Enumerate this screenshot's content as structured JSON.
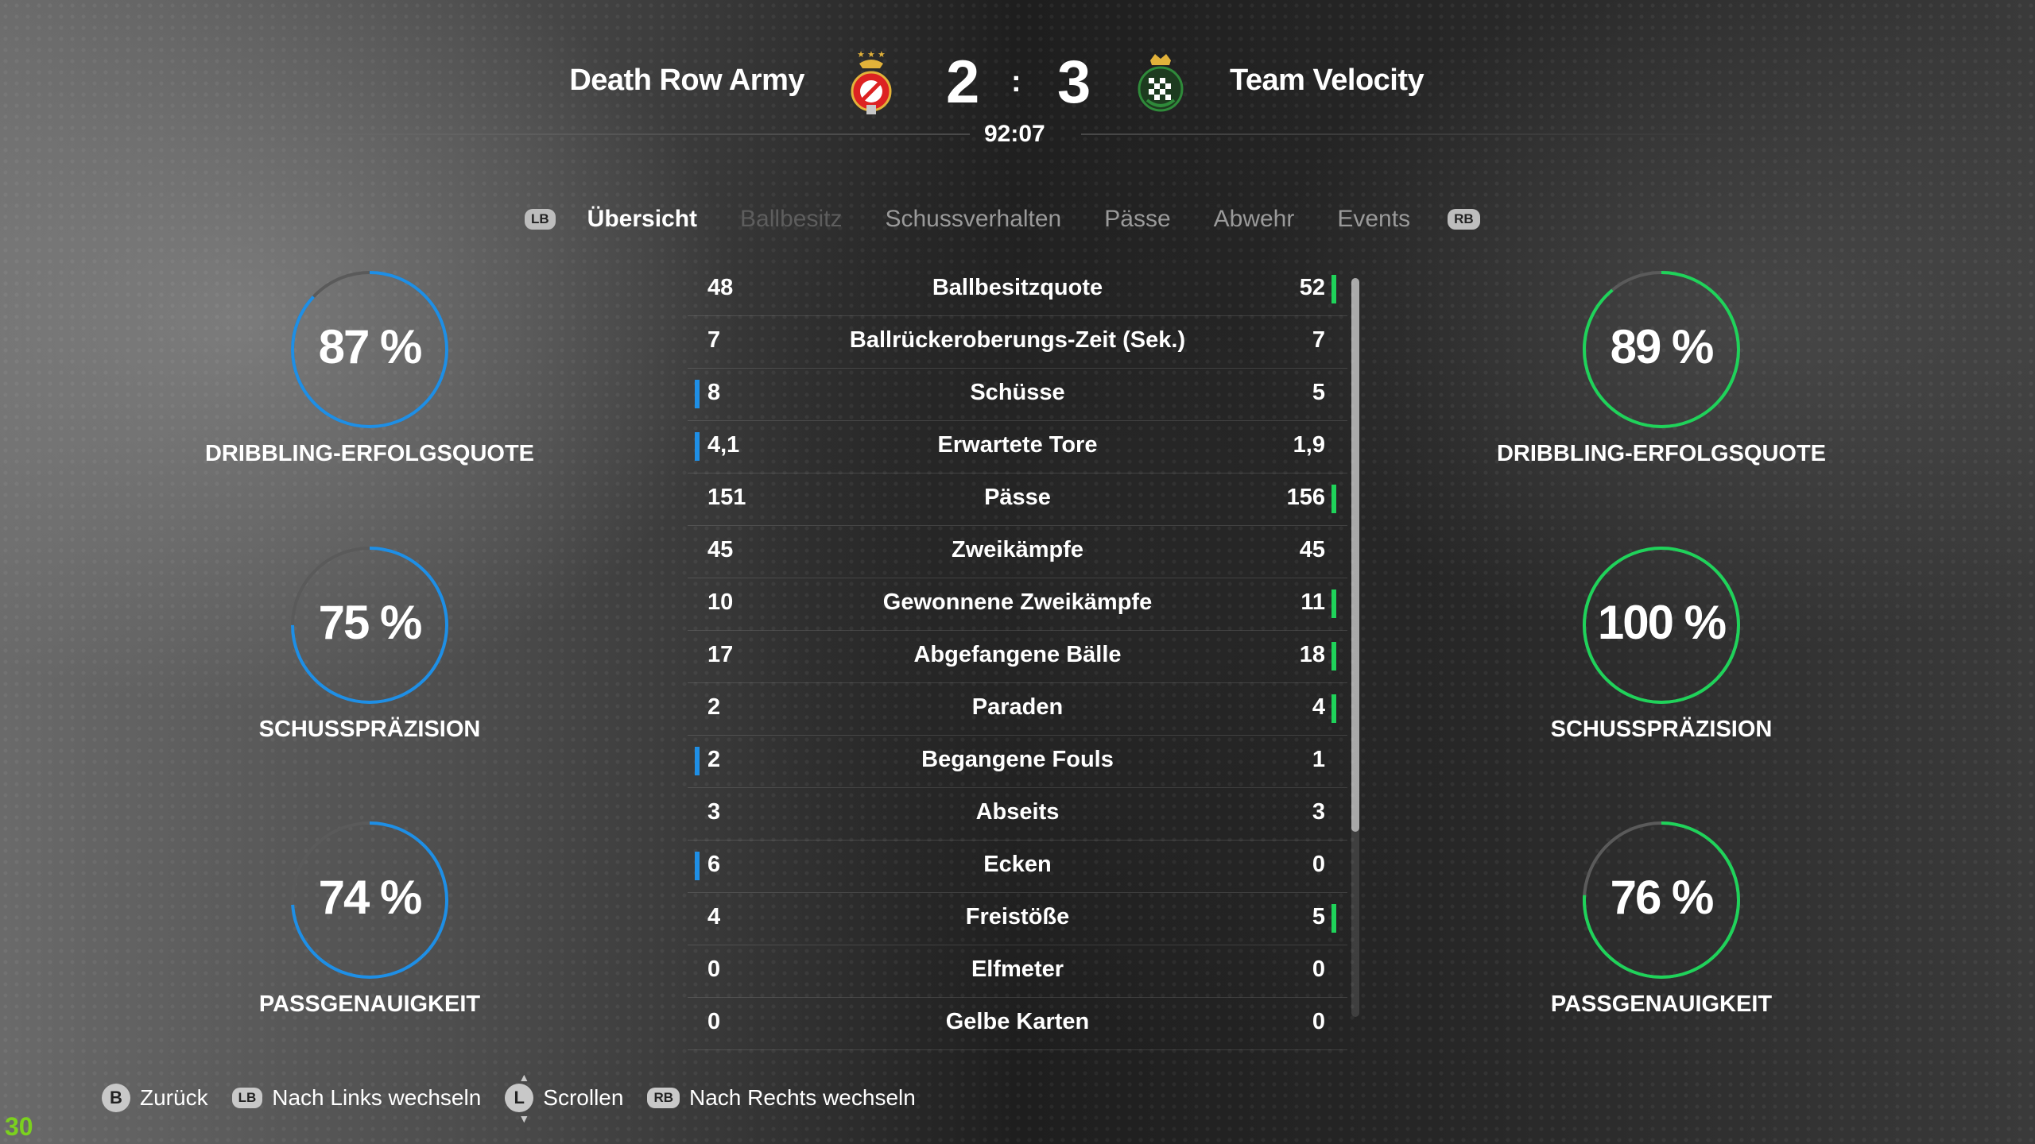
{
  "header": {
    "home_team": "Death Row Army",
    "away_team": "Team Velocity",
    "home_score": "2",
    "away_score": "3",
    "score_separator": ":",
    "match_clock": "92:07"
  },
  "tabs": {
    "lb_hint": "LB",
    "rb_hint": "RB",
    "items": [
      "Übersicht",
      "Ballbesitz",
      "Schussverhalten",
      "Pässe",
      "Abwehr",
      "Events"
    ],
    "active": "Übersicht"
  },
  "stats": [
    {
      "name": "Ballbesitzquote",
      "home": "48",
      "away": "52",
      "leader": "away"
    },
    {
      "name": "Ballrückeroberungs-Zeit (Sek.)",
      "home": "7",
      "away": "7",
      "leader": "none"
    },
    {
      "name": "Schüsse",
      "home": "8",
      "away": "5",
      "leader": "home"
    },
    {
      "name": "Erwartete Tore",
      "home": "4,1",
      "away": "1,9",
      "leader": "home"
    },
    {
      "name": "Pässe",
      "home": "151",
      "away": "156",
      "leader": "away"
    },
    {
      "name": "Zweikämpfe",
      "home": "45",
      "away": "45",
      "leader": "none"
    },
    {
      "name": "Gewonnene Zweikämpfe",
      "home": "10",
      "away": "11",
      "leader": "away"
    },
    {
      "name": "Abgefangene Bälle",
      "home": "17",
      "away": "18",
      "leader": "away"
    },
    {
      "name": "Paraden",
      "home": "2",
      "away": "4",
      "leader": "away"
    },
    {
      "name": "Begangene Fouls",
      "home": "2",
      "away": "1",
      "leader": "home"
    },
    {
      "name": "Abseits",
      "home": "3",
      "away": "3",
      "leader": "none"
    },
    {
      "name": "Ecken",
      "home": "6",
      "away": "0",
      "leader": "home"
    },
    {
      "name": "Freistöße",
      "home": "4",
      "away": "5",
      "leader": "away"
    },
    {
      "name": "Elfmeter",
      "home": "0",
      "away": "0",
      "leader": "none"
    },
    {
      "name": "Gelbe Karten",
      "home": "0",
      "away": "0",
      "leader": "none"
    }
  ],
  "rings": {
    "home": [
      {
        "value": "87 %",
        "pct": 87,
        "label": "DRIBBLING-ERFOLGSQUOTE"
      },
      {
        "value": "75 %",
        "pct": 75,
        "label": "SCHUSSPRÄZISION"
      },
      {
        "value": "74 %",
        "pct": 74,
        "label": "PASSGENAUIGKEIT"
      }
    ],
    "away": [
      {
        "value": "89 %",
        "pct": 89,
        "label": "DRIBBLING-ERFOLGSQUOTE"
      },
      {
        "value": "100 %",
        "pct": 100,
        "label": "SCHUSSPRÄZISION"
      },
      {
        "value": "76 %",
        "pct": 76,
        "label": "PASSGENAUIGKEIT"
      }
    ]
  },
  "colors": {
    "home_accent": "#1e8fe6",
    "away_accent": "#1fd35a",
    "ring_track": "#5a5a5a"
  },
  "footer": {
    "back_key": "B",
    "back_label": "Zurück",
    "left_key": "LB",
    "left_label": "Nach Links wechseln",
    "scroll_key": "L",
    "scroll_label": "Scrollen",
    "right_key": "RB",
    "right_label": "Nach Rechts wechseln"
  },
  "fps_counter": "30"
}
